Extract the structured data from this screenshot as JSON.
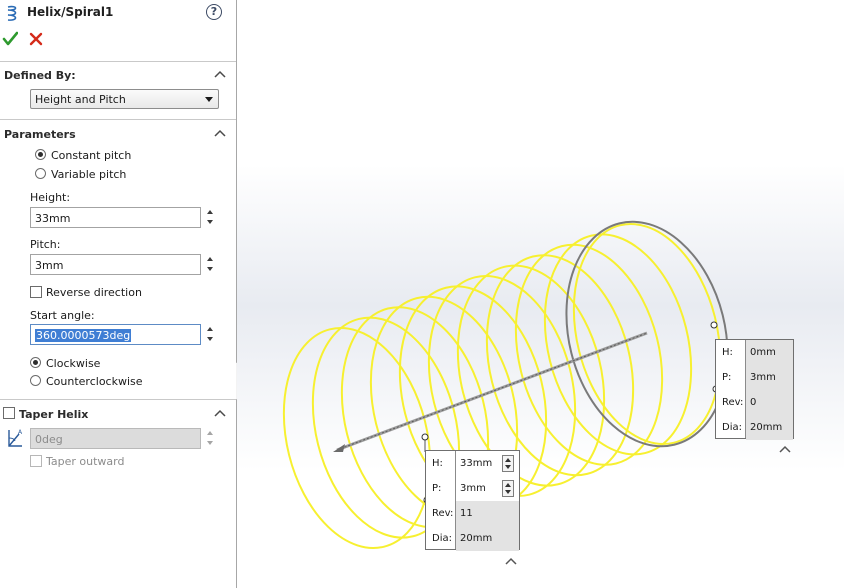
{
  "title": "Helix/Spiral1",
  "help_glyph": "?",
  "defined_by": {
    "header": "Defined By:",
    "selected": "Height and Pitch"
  },
  "parameters": {
    "header": "Parameters",
    "constant_pitch": "Constant pitch",
    "variable_pitch": "Variable pitch",
    "height_label": "Height:",
    "height_value": "33mm",
    "pitch_label": "Pitch:",
    "pitch_value": "3mm",
    "reverse_direction": "Reverse direction",
    "start_angle_label": "Start angle:",
    "start_angle_value": "360.0000573deg",
    "clockwise": "Clockwise",
    "counterclockwise": "Counterclockwise"
  },
  "taper": {
    "header": "Taper Helix",
    "angle_value": "0deg",
    "taper_outward": "Taper outward"
  },
  "callout_start": {
    "h_label": "H:",
    "h_value": "33mm",
    "p_label": "P:",
    "p_value": "3mm",
    "rev_label": "Rev:",
    "rev_value": "11",
    "dia_label": "Dia:",
    "dia_value": "20mm"
  },
  "callout_end": {
    "h_label": "H:",
    "h_value": "0mm",
    "p_label": "P:",
    "p_value": "3mm",
    "rev_label": "Rev:",
    "rev_value": "0",
    "dia_label": "Dia:",
    "dia_value": "20mm"
  },
  "colors": {
    "helix_preview": "#f7f030",
    "end_circle": "#7a7a7a",
    "ok_green": "#2e9a2e",
    "cancel_red": "#d42a1a",
    "selection_blue": "#3f7ed4"
  },
  "icons": {
    "helix_feature": "helix-icon",
    "ok": "checkmark-icon",
    "cancel": "close-icon",
    "help": "help-icon",
    "taper": "taper-angle-icon"
  }
}
